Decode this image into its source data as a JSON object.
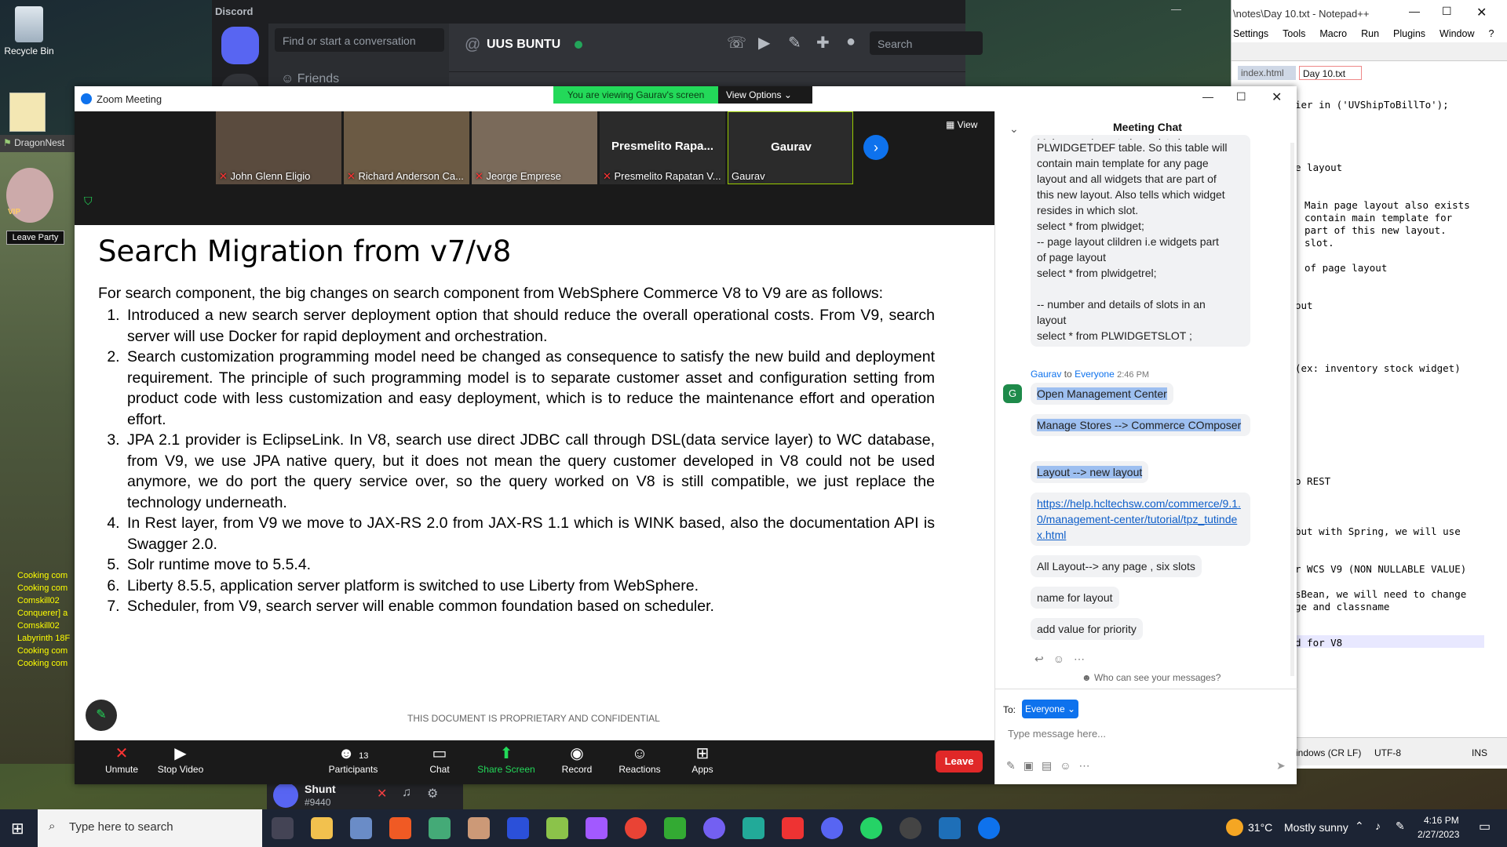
{
  "desktop": {
    "icons": [
      {
        "label": "Recycle Bin"
      },
      {
        "label": "DragonNest"
      }
    ],
    "game": {
      "leave_party": "Leave Party",
      "vip": "VIP",
      "log": [
        "Cooking com",
        "Cooking com",
        "Comskill02 ",
        "Conquerer] a",
        "Comskill02 ",
        "Labyrinth 18F",
        "Cooking com",
        "Cooking com"
      ]
    }
  },
  "discord": {
    "app_title": "Discord",
    "find_placeholder": "Find or start a conversation",
    "channel_name": "UUS BUNTU",
    "search_placeholder": "Search",
    "friends": "Friends",
    "user_name": "Shunt",
    "user_tag": "#9440"
  },
  "notepad": {
    "title": "\\notes\\Day 10.txt - Notepad++",
    "menu": [
      "Settings",
      "Tools",
      "Macro",
      "Run",
      "Plugins",
      "Window",
      "?"
    ],
    "tabs": [
      "index.html",
      "Day 10.txt"
    ],
    "lines": [
      "ier in ('UVShipToBillTo');",
      "e layout",
      "Main page layout also exists",
      "contain main template for",
      "part of this new layout.",
      "slot.",
      "of page layout",
      "out",
      "(ex: inventory stock widget)",
      "o REST",
      "but with Spring, we will use",
      "r WCS V9 (NON NULLABLE VALUE)",
      "sBean, we will need to change",
      "ge and classname",
      "d for V8"
    ],
    "status": {
      "eol": "indows (CR LF)",
      "encoding": "UTF-8",
      "mode": "INS"
    }
  },
  "zoom": {
    "title": "Zoom Meeting",
    "banner": "You are viewing Gaurav's screen",
    "view_options": "View Options",
    "view": "View",
    "participants": [
      {
        "name": "John Glenn Eligio",
        "muted": true
      },
      {
        "name": "Richard Anderson Ca...",
        "muted": true
      },
      {
        "name": "Jeorge Emprese",
        "muted": true
      },
      {
        "name": "Presmelito Rapatan V...",
        "big": "Presmelito  Rapa...",
        "muted": true
      },
      {
        "name": "Gaurav",
        "big": "Gaurav",
        "muted": false
      }
    ],
    "slide": {
      "title": "Search Migration from v7/v8",
      "intro": "For search component, the big changes on search component from WebSphere Commerce V8 to V9 are as follows:",
      "items": [
        "Introduced a new search server deployment option that should reduce the overall operational costs. From V9, search server will use Docker for rapid deployment and orchestration.",
        "Search customization programming model need be changed as consequence to satisfy the new build and deployment requirement. The principle of such programming model is to separate customer asset and configuration setting from product code with less customization and easy deployment, which is to reduce the maintenance effort and operation effort.",
        "JPA 2.1 provider is EclipseLink. In V8, search use direct JDBC call through DSL(data service layer) to WC database, from V9, we use JPA native query, but it does not mean the query customer developed in V8 could not be used anymore, we do port the query service over, so the query worked on V8 is still compatible, we just replace the technology underneath.",
        "In Rest layer, from V9 we move to JAX-RS 2.0 from JAX-RS 1.1 which is WINK based, also the documentation API is Swagger 2.0.",
        "Solr runtime move to 5.5.4.",
        "Liberty 8.5.5, application server platform is switched to use Liberty from WebSphere.",
        "Scheduler, from V9, search server will enable common foundation based on scheduler."
      ],
      "footer": "THIS DOCUMENT IS PROPRIETARY AND CONFIDENTIAL"
    },
    "toolbar": {
      "unmute": "Unmute",
      "stop_video": "Stop Video",
      "participants": "Participants",
      "participants_count": "13",
      "chat": "Chat",
      "share_screen": "Share Screen",
      "record": "Record",
      "reactions": "Reactions",
      "apps": "Apps",
      "leave": "Leave"
    },
    "chat": {
      "title": "Meeting Chat",
      "prev_cut": "Main page layout also exists in",
      "prev_text": [
        "PLWIDGETDEF table. So this table will",
        "contain main template for any page",
        "layout and all widgets that are part of",
        "this new layout. Also tells which widget",
        "resides in which slot.",
        "select * from plwidget;",
        "-- page layout clildren i.e widgets part",
        "of page layout",
        "select * from plwidgetrel;",
        "",
        "-- number and details of slots in an",
        "layout",
        "select * from PLWIDGETSLOT ;"
      ],
      "sender": "Gaurav",
      "to_word": "to",
      "recipient": "Everyone",
      "time": "2:46 PM",
      "avatar": "G",
      "messages": [
        "Open Management Center",
        "Manage Stores --> Commerce COmposer",
        "Layout --> new layout",
        "https://help.hcltechsw.com/commerce/9.1.0/management-center/tutorial/tpz_tutindex.html",
        "All Layout--> any page , six slots",
        "name for layout",
        "add value for priority"
      ],
      "who_can_see": "Who can see your messages?",
      "to_label": "To:",
      "to_value": "Everyone",
      "input_placeholder": "Type message here..."
    }
  },
  "taskbar": {
    "search_placeholder": "Type here to search",
    "weather_temp": "31°C",
    "weather_text": "Mostly sunny",
    "time": "4:16 PM",
    "date": "2/27/2023"
  },
  "colors": {
    "zoom_blue": "#0e72ed",
    "zoom_green": "#23d959",
    "leave_red": "#e02828",
    "discord_blurple": "#5865f2",
    "selection": "#9dbff0"
  }
}
